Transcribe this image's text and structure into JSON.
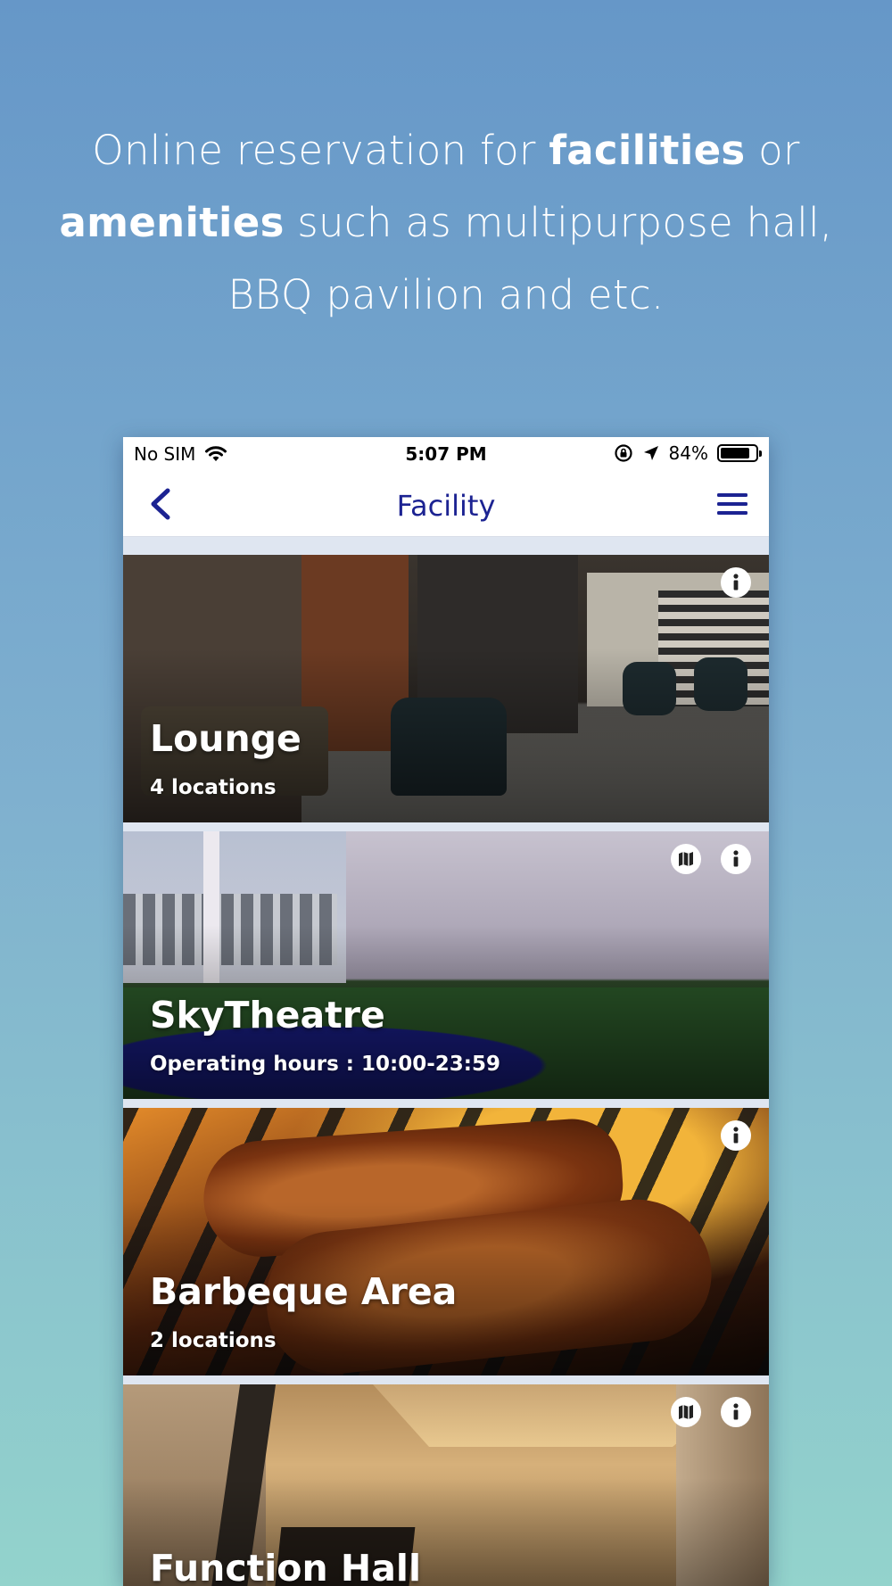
{
  "headline": {
    "line1_pre": "Online reservation for ",
    "line1_bold": "facilities",
    "line1_post": " or",
    "line2_bold": "amenities",
    "line2_post": " such as multipurpose hall,",
    "line3": "BBQ pavilion and etc."
  },
  "status_bar": {
    "carrier": "No SIM",
    "time": "5:07 PM",
    "battery": "84%",
    "battery_level": 0.84
  },
  "nav": {
    "title": "Facility",
    "back_icon": "chevron-left-icon",
    "menu_icon": "hamburger-menu-icon"
  },
  "facilities": [
    {
      "name": "Lounge",
      "subtitle": "4 locations",
      "icons": [
        "info-icon"
      ]
    },
    {
      "name": "SkyTheatre",
      "subtitle": "Operating hours : 10:00-23:59",
      "icons": [
        "map-icon",
        "info-icon"
      ]
    },
    {
      "name": "Barbeque Area",
      "subtitle": "2 locations",
      "icons": [
        "info-icon"
      ]
    },
    {
      "name": "Function Hall",
      "subtitle": "",
      "icons": [
        "map-icon",
        "info-icon"
      ]
    }
  ],
  "colors": {
    "accent": "#1c2392",
    "gradient_top": "#6697c8",
    "gradient_bottom": "#93d3cc"
  }
}
